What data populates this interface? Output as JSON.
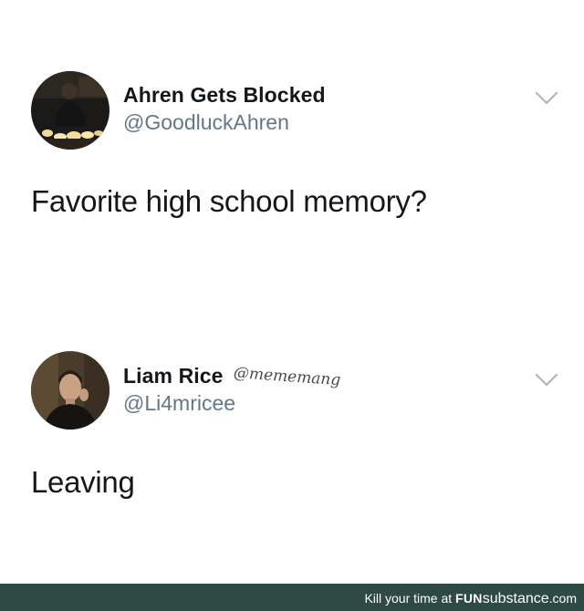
{
  "tweets": [
    {
      "display_name": "Ahren Gets Blocked",
      "handle": "@GoodluckAhren",
      "text": "Favorite high school memory?",
      "menu_icon": "chevron-down-icon"
    },
    {
      "display_name": "Liam Rice",
      "handle": "@Li4mricee",
      "sticker_text": "@mememang",
      "text": "Leaving",
      "menu_icon": "chevron-down-icon"
    }
  ],
  "footer": {
    "tagline": "Kill your time at",
    "brand_bold": "FUN",
    "brand_main": "substance",
    "brand_tld": ".com",
    "background": "#2e4a45"
  },
  "colors": {
    "text_primary": "#14171a",
    "text_secondary": "#657786",
    "chevron": "#aab8c2"
  }
}
